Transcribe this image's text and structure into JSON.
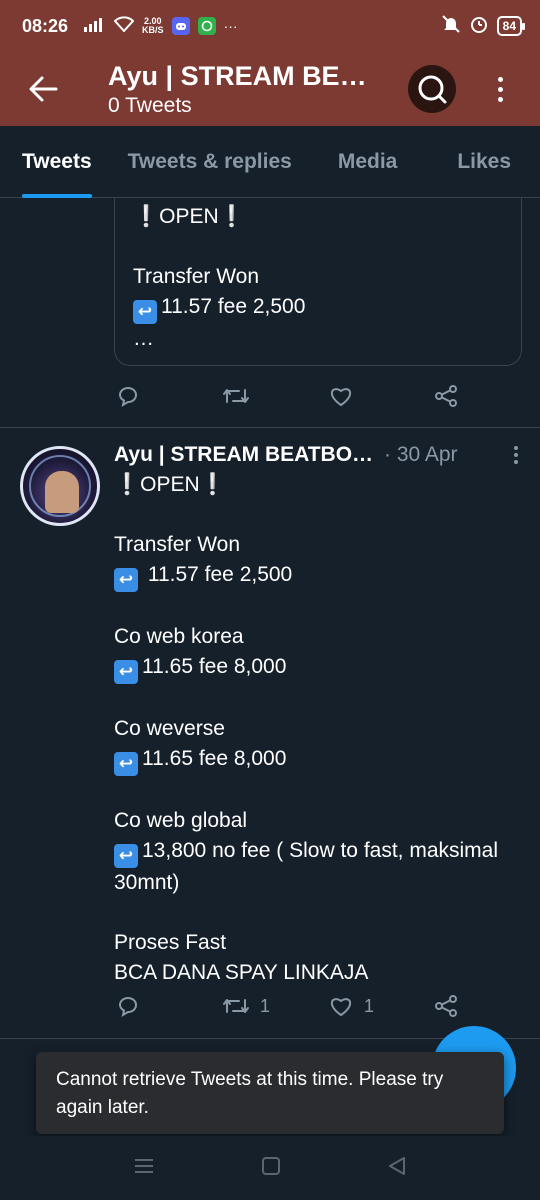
{
  "status_bar": {
    "time": "08:26",
    "net_speed_value": "2.00",
    "net_speed_unit": "KB/S",
    "more_indicator": "···",
    "battery": "84"
  },
  "header": {
    "title": "Ayu | STREAM BE…",
    "subtitle": "0 Tweets",
    "bg_color": "#7c3a32"
  },
  "tabs": [
    {
      "label": "Tweets",
      "active": true
    },
    {
      "label": "Tweets & replies",
      "active": false
    },
    {
      "label": "Media",
      "active": false
    },
    {
      "label": "Likes",
      "active": false
    }
  ],
  "quote_tweet": {
    "line_open": "❕OPEN❕",
    "line_transfer": "Transfer Won",
    "line_rate": "11.57 fee 2,500",
    "ellipsis": "…"
  },
  "tweet": {
    "author": "Ayu | STREAM BEATBOX …",
    "date": "· 30 Apr",
    "open": "❕OPEN❕",
    "sections": [
      {
        "title": "Transfer Won",
        "rate": " 11.57 fee 2,500"
      },
      {
        "title": "Co web korea",
        "rate": "11.65 fee 8,000"
      },
      {
        "title": "Co weverse",
        "rate": "11.65 fee 8,000"
      },
      {
        "title": "Co web global",
        "rate": "13,800 no fee ( Slow to fast, maksimal 30mnt)"
      }
    ],
    "proses": "Proses Fast",
    "payment": "BCA DANA SPAY LINKAJA",
    "retweet_count": "1",
    "like_count": "1"
  },
  "toast": {
    "message": "Cannot retrieve Tweets at this time. Please try again later."
  },
  "colors": {
    "background": "#15202b",
    "accent": "#1d9bf0",
    "muted": "#8b98a5"
  }
}
